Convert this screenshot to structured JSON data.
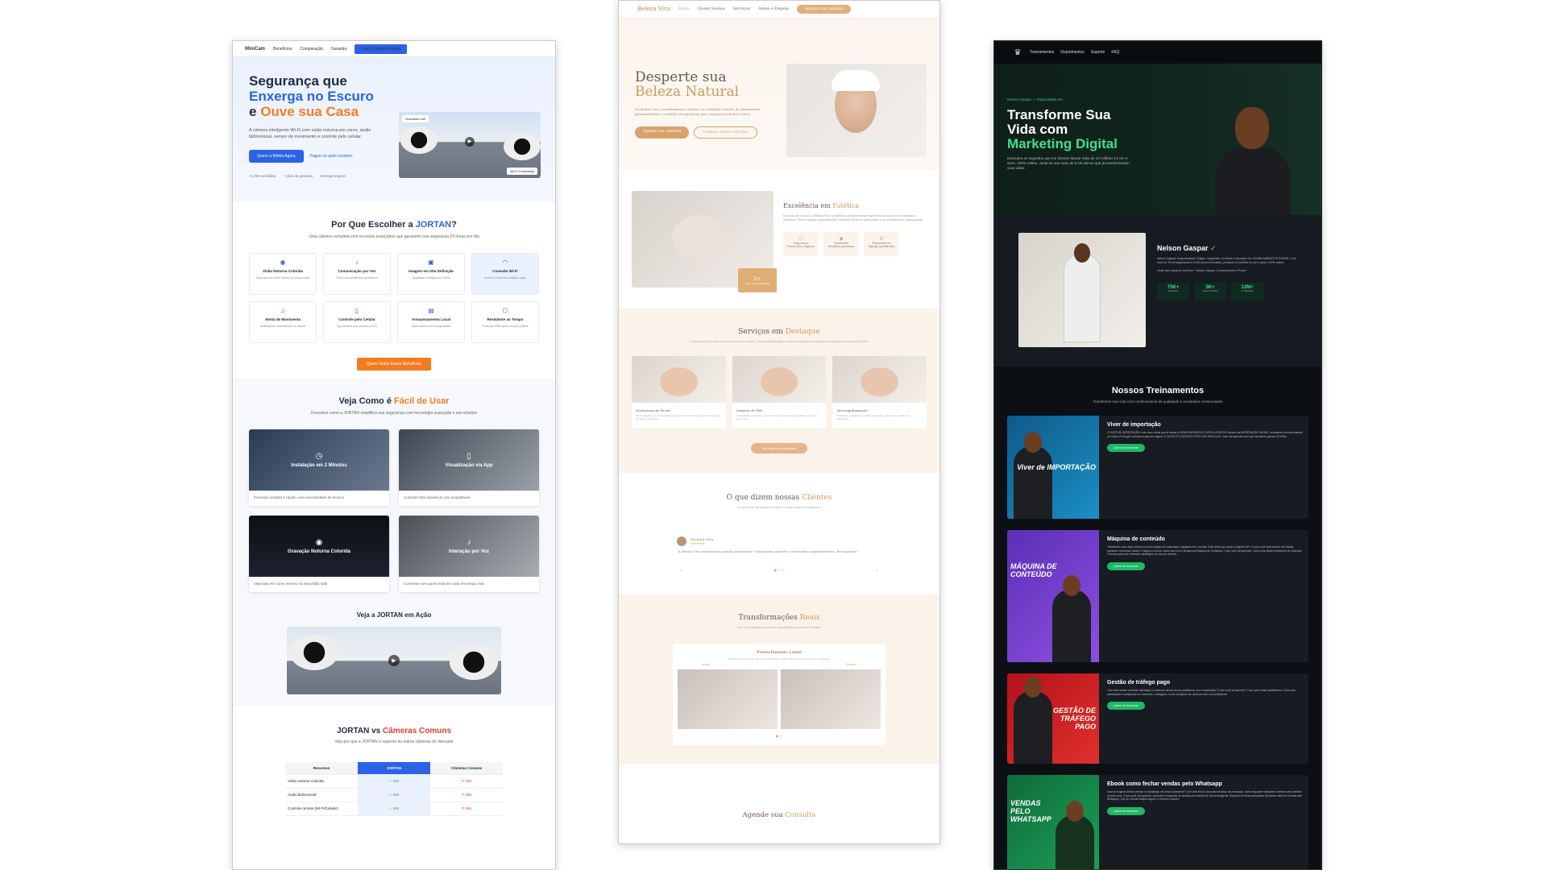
{
  "jortan": {
    "nav": {
      "logo": "MiniCam",
      "links": [
        "Benefícios",
        "Comparação",
        "Garantia"
      ],
      "cta": "Quero Comprar Agora"
    },
    "hero": {
      "title_line1": "Segurança que",
      "title_line2": "Enxerga no Escuro",
      "title_and": "e ",
      "title_line3": "Ouve sua Casa",
      "desc": "A câmera inteligente Wi-Fi com visão noturna em cores, áudio bidirecional, sensor de movimento e controle pelo celular.",
      "btn": "Quero a Minha Agora",
      "link": "Pague só após receber!",
      "trust": [
        "+1.000 vendidas",
        "7 dias de garantia",
        "Entrega segura"
      ],
      "badge_top": "Gravando 24h",
      "badge_bottom": "Wi-Fi Conectado"
    },
    "why": {
      "title_pre": "Por Que Escolher a ",
      "title_brand": "JORTAN",
      "title_post": "?",
      "sub": "Uma câmera completa com recursos avançados que garantem sua segurança 24 horas por dia",
      "features": [
        {
          "title": "Visão Noturna Colorida",
          "desc": "Veja tudo em cores mesmo no escuro total"
        },
        {
          "title": "Comunicação por Voz",
          "desc": "Fale e escute através da câmera"
        },
        {
          "title": "Imagem em Alta Definição",
          "desc": "Qualidade cristalina em 1080p"
        },
        {
          "title": "Conexão Wi-Fi",
          "desc": "Acesso remoto de qualquer lugar"
        },
        {
          "title": "Alerta de Movimento",
          "desc": "Notificações instantâneas no celular"
        },
        {
          "title": "Controle pelo Celular",
          "desc": "App intuitivo para Android e iOS"
        },
        {
          "title": "Armazenamento Local",
          "desc": "Salve vídeos com tranquilidade"
        },
        {
          "title": "Resistente ao Tempo",
          "desc": "Proteção IP66 contra chuva e poeira"
        }
      ],
      "cta": "Quero Todos Esses Benefícios"
    },
    "how": {
      "title_pre": "Veja Como é ",
      "title_hl": "Fácil de Usar",
      "sub": "Descubra como a JORTAN simplifica sua segurança com tecnologia avançada e uso intuitivo",
      "cards": [
        {
          "label": "Instalação em 2 Minutos",
          "caption": "Processo simples e rápido, sem necessidade de técnico"
        },
        {
          "label": "Visualização via App",
          "caption": "Controle total através do seu smartphone"
        },
        {
          "label": "Gravação Noturna Colorida",
          "caption": "Veja tudo em cores mesmo na escuridão total"
        },
        {
          "label": "Interação por Voz",
          "caption": "Converse com quem está em casa em tempo real"
        }
      ],
      "action_title": "Veja a JORTAN em Ação"
    },
    "vs": {
      "title_pre": "JORTAN vs ",
      "title_hl": "Câmeras Comuns",
      "sub": "Veja por que a JORTAN é superior às outras câmeras do mercado",
      "headers": [
        "Recursos",
        "JORTAN",
        "Câmeras Comuns"
      ],
      "rows": [
        [
          "Visão noturna colorida",
          "✓ Sim",
          "✕ Não"
        ],
        [
          "Áudio bidirecional",
          "✓ Sim",
          "✕ Não"
        ],
        [
          "Controle remoto (Wi-Fi/Celular)",
          "✓ Sim",
          "✕ Não"
        ]
      ]
    }
  },
  "beleza": {
    "nav": {
      "logo": "Beleza Viva",
      "links": [
        "Início",
        "Quem Somos",
        "Serviços",
        "Antes e Depois"
      ],
      "cta": "Agende sua consulta"
    },
    "hero": {
      "title_line1": "Desperte sua",
      "title_line2": "Beleza Natural",
      "desc": "Na Beleza Viva, transformamos sonhos em realidade através de tratamentos personalizados e cuidados excepcionais que realçam sua beleza única.",
      "btn1": "Agende sua consulta",
      "btn2": "Conheça nossos serviços"
    },
    "excellence": {
      "title_pre": "Excelência em ",
      "title_hl": "Estética",
      "desc": "Há mais de 5 anos, a Beleza Viva se dedica a proporcionar experiências únicas em cuidados estéticos. Nossa equipe especializada combina técnicas avançadas com atendimento humanizado.",
      "stat": "5+",
      "stat_label": "Anos de experiência",
      "minis": [
        {
          "t": "Segurança",
          "d": "Protocolos seguros"
        },
        {
          "t": "Qualidade",
          "d": "Produtos premium"
        },
        {
          "t": "Especialistas",
          "d": "Equipe qualificada"
        }
      ]
    },
    "services": {
      "title_pre": "Serviços em ",
      "title_hl": "Destaque",
      "sub": "Conheça nossos tratamentos mais procurados, desenvolvidos para realçar sua beleza natural com resultados surpreendentes",
      "cards": [
        {
          "t": "Harmonização Facial",
          "d": "Procedimento de ácido hialurônico para harmonização facial e realce de traços naturais."
        },
        {
          "t": "Limpeza de Pele",
          "d": "Tratamento profundo que remove impurezas e revitaliza a pele do seu rosto."
        },
        {
          "t": "Microagulhamento",
          "d": "Estimula o colágeno e trata cicatrizes, manchas e linhas de expressão."
        }
      ],
      "cta": "Ver todos os serviços"
    },
    "testimonials": {
      "title_pre": "O que dizem nossas ",
      "title_hl": "Clientes",
      "sub": "A satisfação de nossas clientes é nossa maior recompensa",
      "name": "Mariana Silva",
      "stars": "★★★★★",
      "quote": "\"A Beleza Viva transformou minha autoestima! Tratamento incrível e resultados surpreendentes. Recomendo!\""
    },
    "transformations": {
      "title_pre": "Transformações ",
      "title_hl": "Reais",
      "sub": "Veja os resultados incríveis alcançados por nossas clientes",
      "card_title": "Preenchimento Labial",
      "card_desc": "Harmonização labial com ácido hialurônico para lábios mais volumosos e definidos",
      "before": "Antes",
      "after": "Depois"
    },
    "book": {
      "pre": "Agende sua ",
      "hl": "Consulta"
    }
  },
  "nelson": {
    "nav": {
      "links": [
        "Treinamentos",
        "Depoimentos",
        "Suporte",
        "FAQ"
      ]
    },
    "hero": {
      "kicker": "Nelson Gaspar — Especialista em :",
      "title_line1": "Transforme Sua",
      "title_line2": "Vida com",
      "title_line3": "Marketing Digital",
      "desc": "Descubra os segredos que me fizeram faturar mais de 12 milhões Kz em 4 anos, 100% online. Junte-se aos mais de 6 mil alunos que já transformaram suas vidas."
    },
    "about": {
      "name": "Nelson Gaspar",
      "check": "✓",
      "desc1": "Nelson Gaspar: Empreendedor Digital, Copywriter, YouTuber e fundador do CONHECIMENTO É PODER. Com mais de 75 mil seguidores e 5.000 alunos formados, já faturei 12 milhões Kz em 4 anos, 100% online.",
      "desc2": "Visite meu canal no YouTube: \"Nelson Gaspar | Conhecimento é Poder\"",
      "stats": [
        {
          "v": "75K+",
          "l": "Seguidores"
        },
        {
          "v": "5K+",
          "l": "Alunos formados"
        },
        {
          "v": "12M+",
          "l": "Kz Faturados"
        }
      ]
    },
    "trainings": {
      "title": "Nossos Treinamentos",
      "sub": "Transforme sua vida com conhecimento de qualidade e resultados comprovados",
      "courses": [
        {
          "title": "Viver de importação",
          "img_text": "Viver de IMPORTAÇÃO",
          "desc": "O VIVER DE IMPORTAÇÃO é um curso online que te ensina a CRIAR UM NEGÓCIO 100% LUCRATIVO através da IMPORTAÇÃO ONLINE, comprando produtos baratos na China e Portugal e vendendo aqui em Angola. O CURSO É COMPOSTO POR DOIS MÓDULOS. Você vai aprender tudo isso investindo apenas 15.000kz.",
          "btn": "Quero me Inscrever"
        },
        {
          "title": "Máquina de conteúdo",
          "img_text": "MÁQUINA DE CONTEÚDO",
          "desc": "Transforme suas redes sociais em uma máquina de autoridade, engajamento e vendas! Você sente que posta e ninguém vê? Ou que você está sempre sem ideias, copiando e querendo mudar? Chegou a hora de mudar isso com a ferramenta Máquina de Conteúdo. O que você vai aprender: Como criar ideias irresistíveis de conteúdo; Técnicas para criar conteúdo estratégico em poucos minutos.",
          "btn": "Quero me Inscrever"
        },
        {
          "title": "Gestão de tráfego pago",
          "img_text": "GESTÃO DE TRÁFEGO PAGO",
          "desc": "Tudo isso usando conteúdo estratégico e anúncios diretos da sua plataforma, sem complicação! O que você vai aprender: Como gerar leads qualificados; Como criar publicações e campanhas no Facebook e Instagram; Como configurar seu anúncio como um profissional.",
          "btn": "Quero me Inscrever"
        },
        {
          "title": "Ebook como fechar vendas pelo Whatsapp",
          "img_text": "VENDAS PELO WHATSAPP",
          "desc": "Você já imaginou fechar vendas no WhatsApp de forma consistente? Com este ebook, descubra técnicas de persuasão, como responder objeções e atender seus clientes do jeito certo. O que você vai aprender: Aprender a responder às dúvidas dos clientes de forma inteligente; Negociar de forma persuasiva; Aumentar muito em vendas pelo WhatsApp. Crie já o Ebook! Adquira Agora e Comece a vender!",
          "btn": "Quero me Inscrever"
        }
      ]
    }
  }
}
